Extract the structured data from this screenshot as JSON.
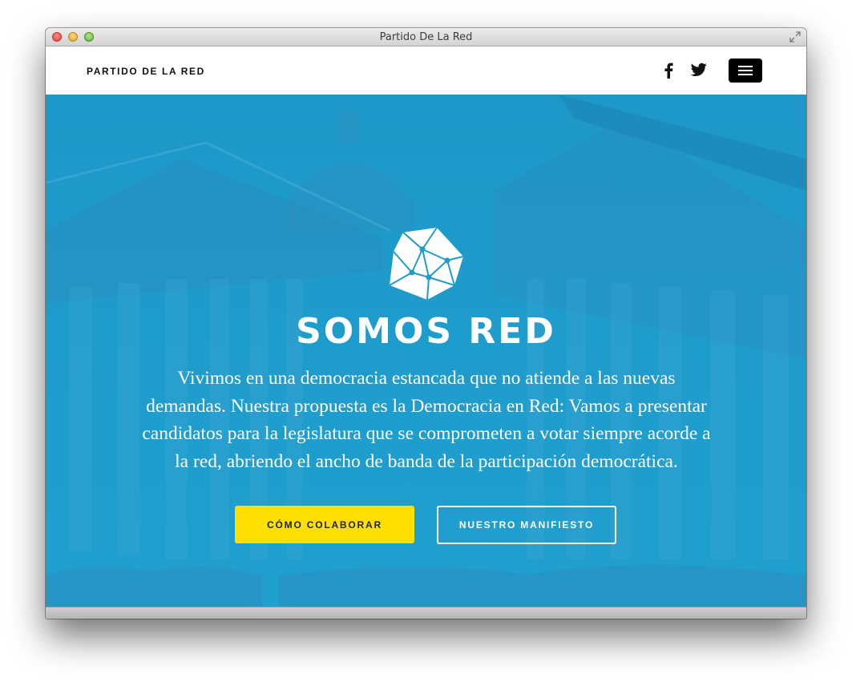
{
  "window": {
    "title": "Partido De La Red"
  },
  "navbar": {
    "brand": "PARTIDO DE LA RED",
    "icons": [
      "facebook-icon",
      "twitter-icon",
      "hamburger-menu-icon"
    ]
  },
  "hero": {
    "title": "SOMOS RED",
    "lines": [
      "Vivimos en una democracia estancada que no atiende a las nuevas",
      "demandas.  Nuestra propuesta es la Democracia en Red:  Vamos a presentar",
      "candidatos para la legislatura que se comprometen a votar siempre acorde a",
      "la red,  abriendo el ancho de banda de la participación democrática."
    ],
    "primary_button": "CÓMO COLABORAR",
    "secondary_button": "NUESTRO MANIFIESTO"
  },
  "colors": {
    "hero_background": "#1f9cca",
    "primary_button": "#fde000",
    "navbar": "#ffffff",
    "menu_button": "#000000"
  }
}
